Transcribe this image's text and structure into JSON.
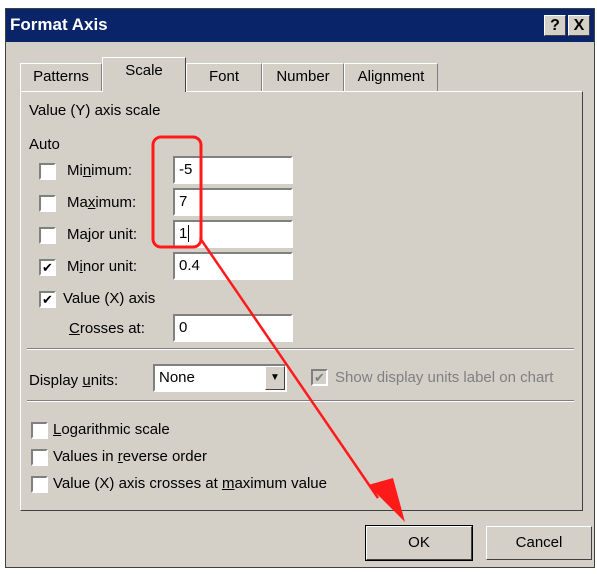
{
  "window": {
    "title": "Format Axis",
    "help_label": "?",
    "close_label": "X"
  },
  "tabs": [
    {
      "label": "Patterns"
    },
    {
      "label": "Scale"
    },
    {
      "label": "Font"
    },
    {
      "label": "Number"
    },
    {
      "label": "Alignment"
    }
  ],
  "scale": {
    "section_title": "Value (Y) axis scale",
    "auto_label": "Auto",
    "rows": [
      {
        "pre": "Mi",
        "acc": "n",
        "post": "imum:",
        "value": "-5",
        "checked": false
      },
      {
        "pre": "Ma",
        "acc": "x",
        "post": "imum:",
        "value": "7",
        "checked": false
      },
      {
        "pre": "Ma",
        "acc": "j",
        "post": "or unit:",
        "value": "1",
        "checked": false
      },
      {
        "pre": "M",
        "acc": "i",
        "post": "nor unit:",
        "value": "0.4",
        "checked": true
      }
    ],
    "crosses_check": {
      "label": "Value (X) axis",
      "checked": true
    },
    "crosses_at": {
      "pre": "",
      "acc": "C",
      "post": "rosses at:",
      "value": "0"
    }
  },
  "display_units": {
    "pre": "Display ",
    "acc": "u",
    "post": "nits:",
    "selected": "None",
    "show_label": "Show display units label on chart",
    "show_checked": true
  },
  "options": [
    {
      "pre": "",
      "acc": "L",
      "post": "ogarithmic scale",
      "checked": false
    },
    {
      "pre": "Values in ",
      "acc": "r",
      "post": "everse order",
      "checked": false
    },
    {
      "pre": "Value (X) axis crosses at ",
      "acc": "m",
      "post": "aximum value",
      "checked": false
    }
  ],
  "buttons": {
    "ok": "OK",
    "cancel": "Cancel"
  },
  "colors": {
    "title_bar": "#0a246a",
    "dialog_face": "#d4d0c8",
    "annotation": "#ff1a1a"
  }
}
